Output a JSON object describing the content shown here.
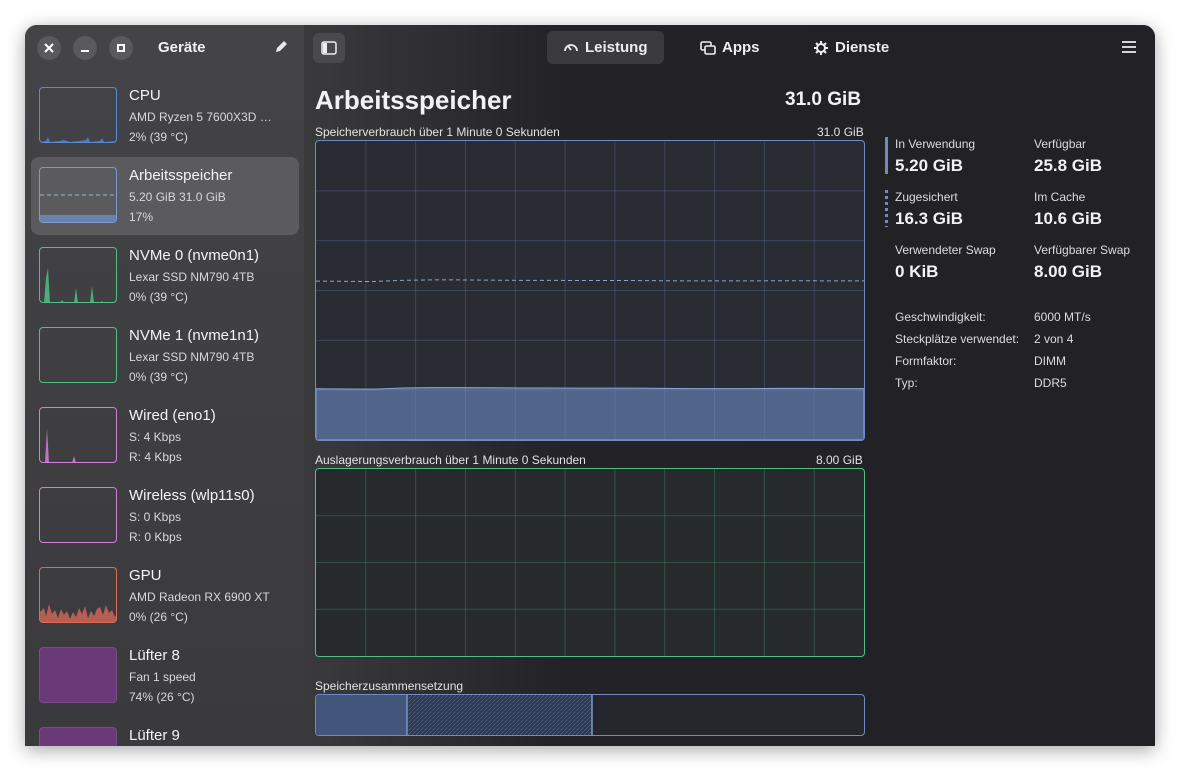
{
  "sidebar": {
    "title": "Geräte",
    "devices": [
      {
        "name": "CPU",
        "line2": "AMD Ryzen 5 7600X3D …",
        "line3": "2% (39 °C)",
        "color": "#5a8ad8"
      },
      {
        "name": "Arbeitsspeicher",
        "line2": "5.20 GiB 31.0 GiB",
        "line3": "17%",
        "color": "#7a9ad0"
      },
      {
        "name": "NVMe 0 (nvme0n1)",
        "line2": "Lexar SSD NM790 4TB",
        "line3": "0% (39 °C)",
        "color": "#4fbf87"
      },
      {
        "name": "NVMe 1 (nvme1n1)",
        "line2": "Lexar SSD NM790 4TB",
        "line3": "0% (39 °C)",
        "color": "#4fbf87"
      },
      {
        "name": "Wired (eno1)",
        "line2": "S: 4 Kbps",
        "line3": "R: 4 Kbps",
        "color": "#d27fd6"
      },
      {
        "name": "Wireless (wlp11s0)",
        "line2": "S: 0 Kbps",
        "line3": "R: 0 Kbps",
        "color": "#d27fd6"
      },
      {
        "name": "GPU",
        "line2": "AMD Radeon RX 6900 XT",
        "line3": "0% (26 °C)",
        "color": "#e06a5a"
      },
      {
        "name": "Lüfter 8",
        "line2": "Fan 1 speed",
        "line3": "74% (26 °C)",
        "color": "#7a4a8a"
      },
      {
        "name": "Lüfter 9",
        "line2": "",
        "line3": "",
        "color": "#7a4a8a"
      }
    ]
  },
  "tabs": [
    {
      "label": "Leistung",
      "icon": "gauge-icon"
    },
    {
      "label": "Apps",
      "icon": "windows-icon"
    },
    {
      "label": "Dienste",
      "icon": "gear-icon"
    }
  ],
  "main": {
    "title": "Arbeitsspeicher",
    "total": "31.0 GiB",
    "mem_caption": "Speicherverbrauch über 1 Minute 0 Sekunden",
    "mem_max": "31.0 GiB",
    "swap_caption": "Auslagerungsverbrauch über 1 Minute 0 Sekunden",
    "swap_max": "8.00 GiB",
    "composition_caption": "Speicherzusammensetzung",
    "usage_fraction": 0.17,
    "committed_fraction": 0.53
  },
  "stats": {
    "in_use_label": "In Verwendung",
    "in_use": "5.20 GiB",
    "available_label": "Verfügbar",
    "available": "25.8 GiB",
    "committed_label": "Zugesichert",
    "committed": "16.3 GiB",
    "cache_label": "Im Cache",
    "cache": "10.6 GiB",
    "swap_used_label": "Verwendeter Swap",
    "swap_used": "0 KiB",
    "swap_avail_label": "Verfügbarer Swap",
    "swap_avail": "8.00 GiB"
  },
  "info": [
    {
      "label": "Geschwindigkeit:",
      "value": "6000 MT/s"
    },
    {
      "label": "Steckplätze verwendet:",
      "value": "2 von 4"
    },
    {
      "label": "Formfaktor:",
      "value": "DIMM"
    },
    {
      "label": "Typ:",
      "value": "DDR5"
    }
  ],
  "colors": {
    "memory": "#7a9ad0",
    "swap": "#4fbf87",
    "accent": "#5a8ad8"
  }
}
